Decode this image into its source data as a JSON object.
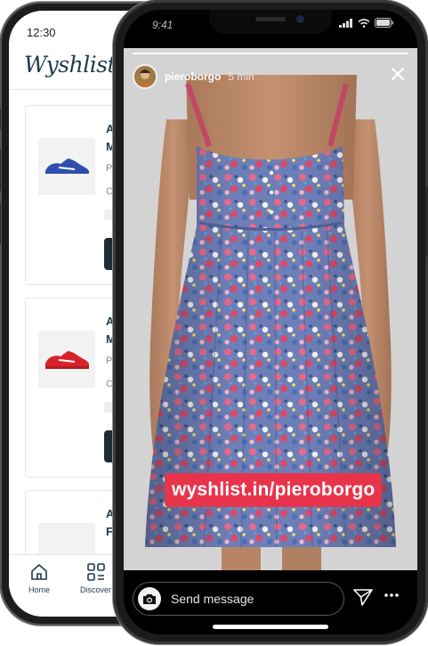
{
  "back_phone": {
    "status_time": "12:30",
    "logo": "Wyshlist",
    "cards": [
      {
        "title_lines": [
          "A",
          "M"
        ],
        "sub1": "P",
        "sub2": "C",
        "shoe_color": "#2f4fae"
      },
      {
        "title_lines": [
          "A",
          "M"
        ],
        "sub1": "P",
        "sub2": "C",
        "shoe_color": "#d8222a"
      },
      {
        "title_lines": [
          "A",
          "Fl"
        ],
        "sub1": "",
        "sub2": "",
        "shoe_color": "#cccccc"
      }
    ],
    "tabs": [
      {
        "label": "Home",
        "icon": "home-icon"
      },
      {
        "label": "Discover",
        "icon": "grid-icon"
      }
    ]
  },
  "front_phone": {
    "status_time": "9:41",
    "story": {
      "username": "pieroborgo",
      "time_ago": "5 min",
      "link_text": "wyshlist.in/pieroborgo",
      "progress": 1.0
    },
    "message_placeholder": "Send message",
    "colors": {
      "link_sticker": "#e8344b",
      "app_navy": "#1d3a4c"
    }
  }
}
